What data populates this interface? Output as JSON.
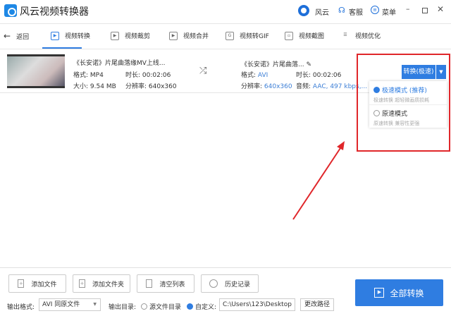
{
  "app": {
    "title": "风云视频转换器",
    "user": "风云",
    "service": "客服",
    "menu": "菜单"
  },
  "nav": {
    "back": "返回",
    "tabs": [
      {
        "label": "视频转换",
        "icon": "play-icon"
      },
      {
        "label": "视频裁剪",
        "icon": "crop-icon"
      },
      {
        "label": "视频合并",
        "icon": "merge-icon"
      },
      {
        "label": "视频转GIF",
        "icon": "gif-icon"
      },
      {
        "label": "视频截图",
        "icon": "screenshot-icon"
      },
      {
        "label": "视频优化",
        "icon": "sliders-icon"
      }
    ]
  },
  "file": {
    "src_name": "《长安诺》片尾曲落缘MV上线...",
    "src_format_label": "格式:",
    "src_format": "MP4",
    "src_duration_label": "时长:",
    "src_duration": "00:02:06",
    "src_size_label": "大小:",
    "src_size": "9.54 MB",
    "src_res_label": "分辨率:",
    "src_res": "640x360",
    "dst_name": "《长安诺》片尾曲落...",
    "dst_format_label": "格式:",
    "dst_format": "AVI",
    "dst_duration_label": "时长:",
    "dst_duration": "00:02:06",
    "dst_res_label": "分辨率:",
    "dst_res": "640x360",
    "dst_audio_label": "音频:",
    "dst_audio": "AAC, 497 kbps,..."
  },
  "convert": {
    "label": "转换(极速)",
    "options": [
      {
        "title": "极速模式 (推荐)",
        "desc": "极速转换 超轻微画质损耗",
        "selected": true
      },
      {
        "title": "原速模式",
        "desc": "原速转换 兼容性更强",
        "selected": false
      }
    ]
  },
  "toolbar": {
    "add_file": "添加文件",
    "add_folder": "添加文件夹",
    "clear": "清空列表",
    "history": "历史记录",
    "convert_all": "全部转换"
  },
  "output": {
    "format_label": "输出格式:",
    "format": "AVI 同原文件",
    "dir_label": "输出目录:",
    "source_dir": "源文件目录",
    "custom": "自定义:",
    "path": "C:\\Users\\123\\Desktop",
    "change": "更改路径"
  },
  "colors": {
    "accent": "#2f7de1",
    "highlight": "#e0262a"
  }
}
